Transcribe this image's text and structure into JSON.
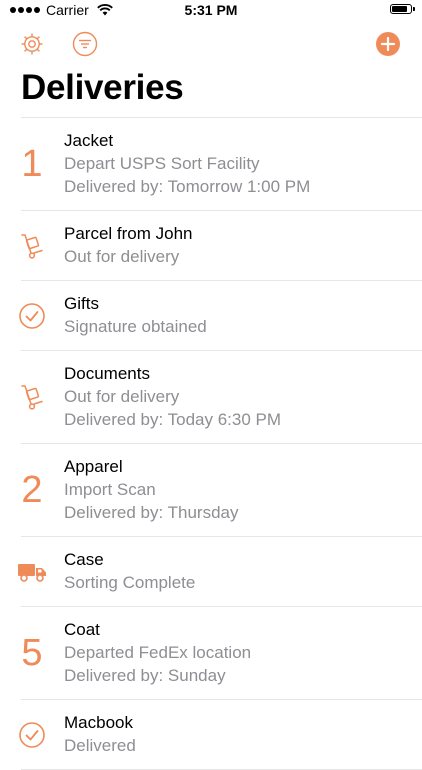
{
  "status_bar": {
    "carrier": "Carrier",
    "time": "5:31 PM",
    "battery_level": 0.9
  },
  "header": {
    "title": "Deliveries"
  },
  "colors": {
    "accent": "#ef8b59",
    "secondary_text": "#8e8e93",
    "separator": "#e6e6e6"
  },
  "icons": {
    "settings": "gear-icon",
    "filter": "filter-icon",
    "add": "plus-circle-icon"
  },
  "items": [
    {
      "title": "Jacket",
      "status": "Depart USPS Sort Facility",
      "eta": "Delivered by: Tomorrow 1:00 PM",
      "badge": "1",
      "icon": "number"
    },
    {
      "title": "Parcel from John",
      "status": "Out for delivery",
      "icon": "hand-truck-icon"
    },
    {
      "title": "Gifts",
      "status": "Signature obtained",
      "icon": "checkmark-circle-icon"
    },
    {
      "title": "Documents",
      "status": "Out for delivery",
      "eta": "Delivered by: Today 6:30 PM",
      "icon": "hand-truck-icon"
    },
    {
      "title": "Apparel",
      "status": "Import Scan",
      "eta": "Delivered by: Thursday",
      "badge": "2",
      "icon": "number"
    },
    {
      "title": "Case",
      "status": "Sorting Complete",
      "icon": "truck-icon"
    },
    {
      "title": "Coat",
      "status": "Departed FedEx location",
      "eta": "Delivered by: Sunday",
      "badge": "5",
      "icon": "number"
    },
    {
      "title": "Macbook",
      "status": "Delivered",
      "icon": "checkmark-circle-icon"
    }
  ]
}
